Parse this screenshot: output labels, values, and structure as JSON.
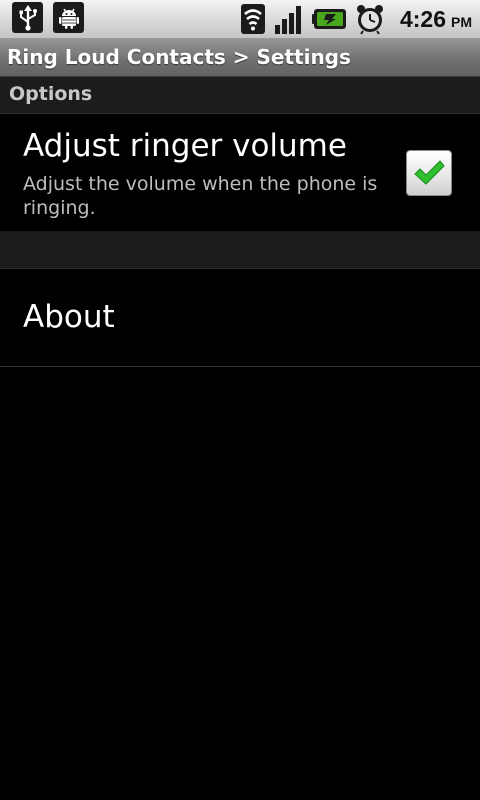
{
  "status_bar": {
    "notification_icons": [
      "usb-icon",
      "android-debug-icon"
    ],
    "system_icons": [
      "wifi-icon",
      "signal-icon",
      "battery-charging-icon",
      "alarm-clock-icon"
    ],
    "time": "4:26",
    "ampm": "PM"
  },
  "title_bar": {
    "title": "Ring Loud Contacts > Settings"
  },
  "options_category": {
    "label": "Options"
  },
  "adjust_volume_pref": {
    "title": "Adjust ringer volume",
    "summary": "Adjust the volume when the phone is ringing.",
    "checked": true
  },
  "about_pref": {
    "title": "About"
  },
  "colors": {
    "check_green": "#2fbf2f",
    "battery_green": "#4aa81e"
  }
}
